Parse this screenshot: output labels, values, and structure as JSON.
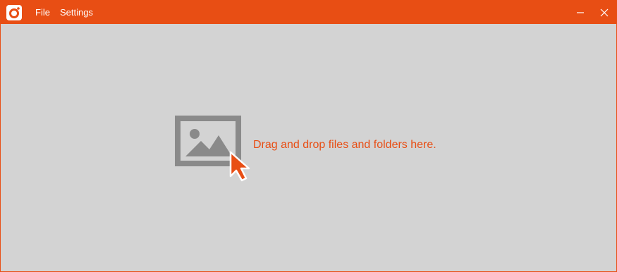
{
  "menu": {
    "file_label": "File",
    "settings_label": "Settings"
  },
  "dropzone": {
    "text": "Drag and drop files and folders here."
  },
  "icons": {
    "app": "app-logo-icon",
    "minimize": "minimize-icon",
    "close": "close-icon",
    "image": "image-icon",
    "cursor": "cursor-arrow-icon"
  },
  "colors": {
    "accent": "#e84e14",
    "background": "#d3d3d3",
    "graphic": "#8a8a8a"
  }
}
